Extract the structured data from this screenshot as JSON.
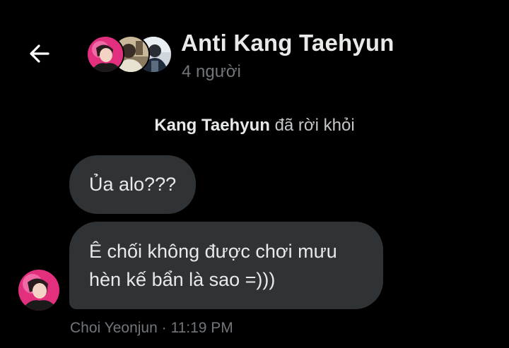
{
  "header": {
    "back_icon": "arrow-left-icon",
    "title": "Anti Kang Taehyun",
    "subtitle": "4 người",
    "avatars": [
      "group-member-avatar-1",
      "group-member-avatar-2",
      "group-member-avatar-3"
    ]
  },
  "system_message": {
    "name": "Kang Taehyun",
    "text": "đã rời khỏi"
  },
  "messages": [
    {
      "text": "Ủa alo???"
    },
    {
      "text": "Ê chối không được chơi mưu hèn kế bẩn là sao =)))"
    }
  ],
  "footer": {
    "sender": "Choi Yeonjun",
    "separator": " · ",
    "time": "11:19 PM"
  },
  "colors": {
    "background": "#000000",
    "bubble": "#2f3336",
    "text": "#e7e9ea",
    "muted": "#71767b"
  }
}
